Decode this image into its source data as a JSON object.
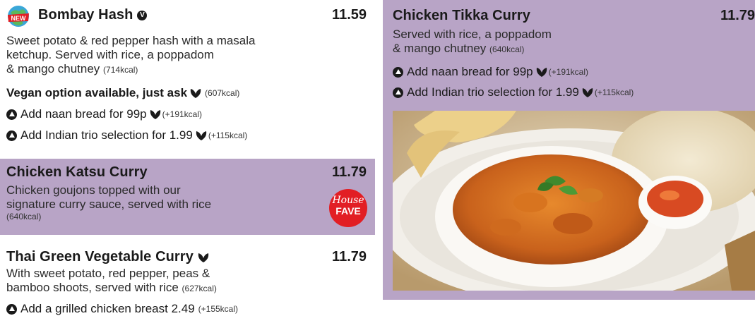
{
  "items": {
    "bombay": {
      "new_badge": "NEW",
      "name": "Bombay Hash",
      "veggie_badge": "V",
      "price": "11.59",
      "desc_l1": "Sweet potato & red pepper hash with a masala",
      "desc_l2": "ketchup. Served with rice, a poppadom",
      "desc_l3": "& mango chutney",
      "kcal": "(714kcal)",
      "vegan_label": "Vegan option available, just ask",
      "vegan_kcal": "(607kcal)",
      "addon1_label": "Add naan bread for 99p",
      "addon1_kcal": "(+191kcal)",
      "addon2_label": "Add Indian trio selection for 1.99",
      "addon2_kcal": "(+115kcal)"
    },
    "katsu": {
      "name": "Chicken Katsu Curry",
      "price": "11.79",
      "desc_l1": "Chicken goujons topped with our",
      "desc_l2": "signature curry sauce, served with rice",
      "kcal": "(640kcal)",
      "badge_line1": "House",
      "badge_line2": "FAVE"
    },
    "thai": {
      "name": "Thai Green Vegetable Curry",
      "price": "11.79",
      "desc_l1": "With sweet potato, red pepper, peas &",
      "desc_l2": "bamboo shoots, served with rice",
      "kcal": "(627kcal)",
      "addon1_label": "Add a grilled chicken breast 2.49",
      "addon1_kcal": "(+155kcal)"
    },
    "tikka": {
      "name": "Chicken Tikka Curry",
      "price": "11.79",
      "desc_l1": "Served with rice, a poppadom",
      "desc_l2": "& mango chutney",
      "kcal": "(640kcal)",
      "addon1_label": "Add naan bread for 99p",
      "addon1_kcal": "(+191kcal)",
      "addon2_label": "Add Indian trio selection for 1.99",
      "addon2_kcal": "(+115kcal)"
    }
  },
  "colors": {
    "panel": "#b8a4c6",
    "badge_red": "#e21e24",
    "text": "#1a1a1a"
  }
}
